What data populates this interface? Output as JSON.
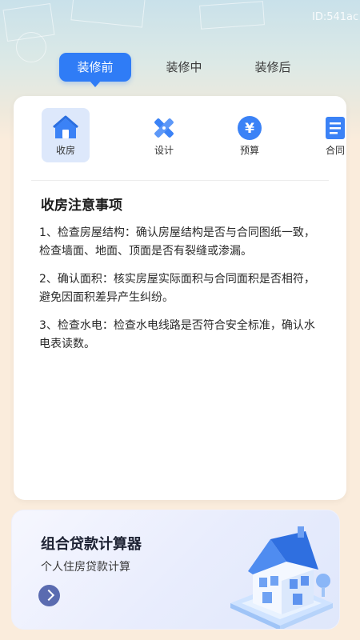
{
  "header": {
    "device_id": "ID:541ac"
  },
  "tabs": [
    {
      "label": "装修前",
      "active": true
    },
    {
      "label": "装修中",
      "active": false
    },
    {
      "label": "装修后",
      "active": false
    }
  ],
  "categories": [
    {
      "label": "收房",
      "icon": "home-icon",
      "active": true
    },
    {
      "label": "设计",
      "icon": "ruler-pencil-icon",
      "active": false
    },
    {
      "label": "预算",
      "icon": "yuan-coin-icon",
      "active": false
    },
    {
      "label": "合同",
      "icon": "document-icon",
      "active": false
    }
  ],
  "notes": {
    "title": "收房注意事项",
    "items": [
      "1、检查房屋结构：确认房屋结构是否与合同图纸一致，检查墙面、地面、顶面是否有裂缝或渗漏。",
      "2、确认面积：核实房屋实际面积与合同面积是否相符，避免因面积差异产生纠纷。",
      "3、检查水电：检查水电线路是否符合安全标准，确认水电表读数。"
    ]
  },
  "loan_card": {
    "title": "组合贷款计算器",
    "subtitle": "个人住房贷款计算",
    "icon": "house-illustration"
  },
  "colors": {
    "accent": "#2f7cf6",
    "page_bg": "#faecdc",
    "card_bg": "#ffffff",
    "loan_button": "#5a6bb0"
  }
}
